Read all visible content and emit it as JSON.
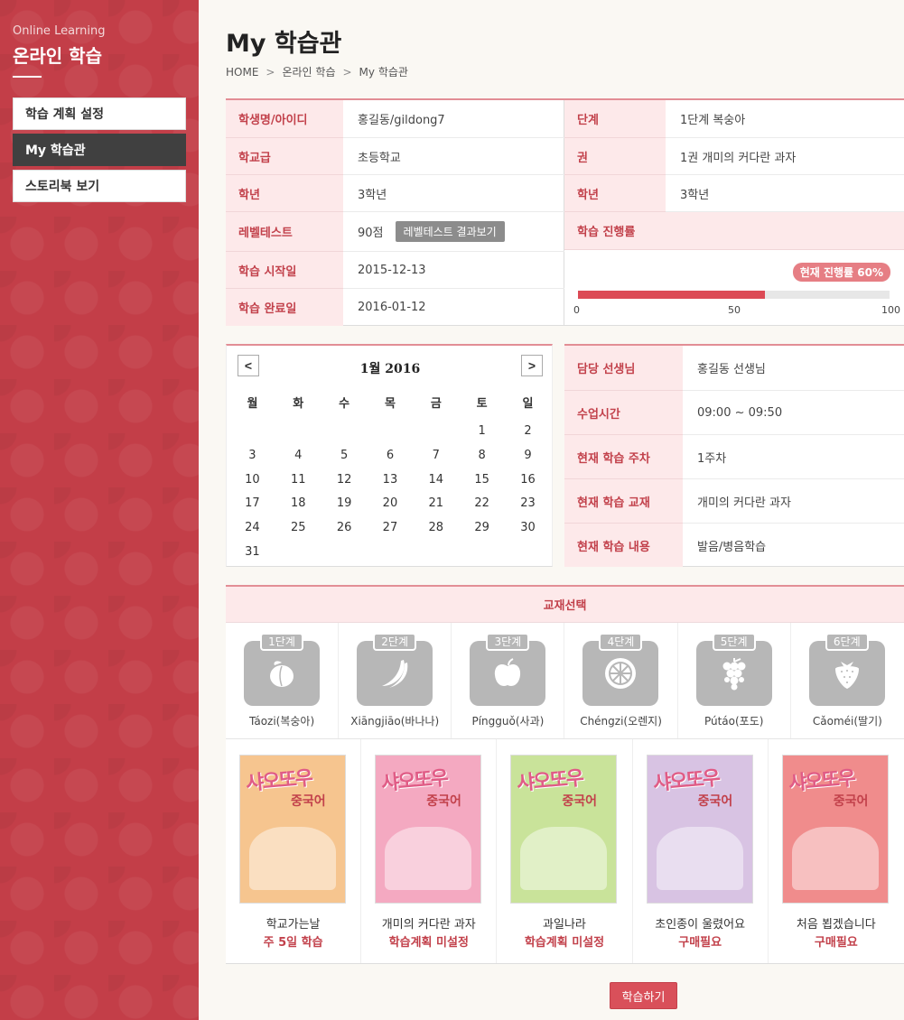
{
  "sidebar": {
    "subtitle": "Online Learning",
    "title": "온라인 학습",
    "items": [
      {
        "label": "학습 계획 설정",
        "active": false
      },
      {
        "label": "My 학습관",
        "active": true
      },
      {
        "label": "스토리북 보기",
        "active": false
      }
    ]
  },
  "header": {
    "title": "My 학습관",
    "breadcrumb": [
      "HOME",
      "온라인 학습",
      "My 학습관"
    ]
  },
  "info": {
    "left": [
      {
        "label": "학생명/아이디",
        "value": "홍길동/gildong7"
      },
      {
        "label": "학교급",
        "value": "초등학교"
      },
      {
        "label": "학년",
        "value": "3학년"
      },
      {
        "label": "레벨테스트",
        "value": "90점"
      },
      {
        "label": "학습 시작일",
        "value": "2015-12-13"
      },
      {
        "label": "학습 완료일",
        "value": "2016-01-12"
      }
    ],
    "result_button": "레벨테스트 결과보기",
    "right": [
      {
        "label": "단계",
        "value": "1단계 복숭아"
      },
      {
        "label": "권",
        "value": "1권 개미의 커다란 과자"
      },
      {
        "label": "학년",
        "value": "3학년"
      }
    ],
    "progress": {
      "label": "학습 진행률",
      "badge": "현재 진행률 60%",
      "percent": 60,
      "scale": [
        "0",
        "50",
        "100"
      ]
    }
  },
  "calendar": {
    "title": "1월 2016",
    "weekdays": [
      "월",
      "화",
      "수",
      "목",
      "금",
      "토",
      "일"
    ],
    "weeks": [
      [
        "",
        "",
        "",
        "",
        "",
        "1",
        "2"
      ],
      [
        "3",
        "4",
        "5",
        "6",
        "7",
        "8",
        "9"
      ],
      [
        "10",
        "11",
        "12",
        "13",
        "14",
        "15",
        "16"
      ],
      [
        "17",
        "18",
        "19",
        "20",
        "21",
        "22",
        "23"
      ],
      [
        "24",
        "25",
        "26",
        "27",
        "28",
        "29",
        "30"
      ],
      [
        "31",
        "",
        "",
        "",
        "",
        "",
        ""
      ]
    ],
    "prev_icon": "chevron-left-icon",
    "next_icon": "chevron-right-icon"
  },
  "teacher": [
    {
      "label": "담당 선생님",
      "value": "홍길동 선생님"
    },
    {
      "label": "수업시간",
      "value": "09:00 ~ 09:50"
    },
    {
      "label": "현재 학습 주차",
      "value": "1주차"
    },
    {
      "label": "현재 학습 교재",
      "value": "개미의 커다란 과자"
    },
    {
      "label": "현재 학습 내용",
      "value": "발음/병음학습"
    }
  ],
  "textbook": {
    "header": "교재선택",
    "stages": [
      {
        "tab": "1단계",
        "name": "Táozi(복숭아)",
        "icon": "peach-icon"
      },
      {
        "tab": "2단계",
        "name": "Xiāngjiāo(바나나)",
        "icon": "banana-icon"
      },
      {
        "tab": "3단계",
        "name": "Píngguǒ(사과)",
        "icon": "apple-icon"
      },
      {
        "tab": "4단계",
        "name": "Chéngzi(오렌지)",
        "icon": "orange-icon"
      },
      {
        "tab": "5단계",
        "name": "Pútáo(포도)",
        "icon": "grape-icon"
      },
      {
        "tab": "6단계",
        "name": "Cǎoméi(딸기)",
        "icon": "strawberry-icon"
      }
    ],
    "books": [
      {
        "name": "학교가는날",
        "status": "주 5일 학습",
        "cover_title": "샤오또우",
        "cover_sub": "중국어",
        "bg": "#f6c58f"
      },
      {
        "name": "개미의 커다란 과자",
        "status": "학습계획 미설정",
        "cover_title": "샤오또우",
        "cover_sub": "중국어",
        "bg": "#f4a9c1"
      },
      {
        "name": "과일나라",
        "status": "학습계획 미설정",
        "cover_title": "샤오또우",
        "cover_sub": "중국어",
        "bg": "#c9e39a"
      },
      {
        "name": "초인종이 울렸어요",
        "status": "구매필요",
        "cover_title": "샤오또우",
        "cover_sub": "중국어",
        "bg": "#d8c3e3"
      },
      {
        "name": "처음 뵙겠습니다",
        "status": "구매필요",
        "cover_title": "샤오또우",
        "cover_sub": "중국어",
        "bg": "#f08c8c"
      }
    ]
  },
  "actions": {
    "start_label": "학습하기"
  }
}
